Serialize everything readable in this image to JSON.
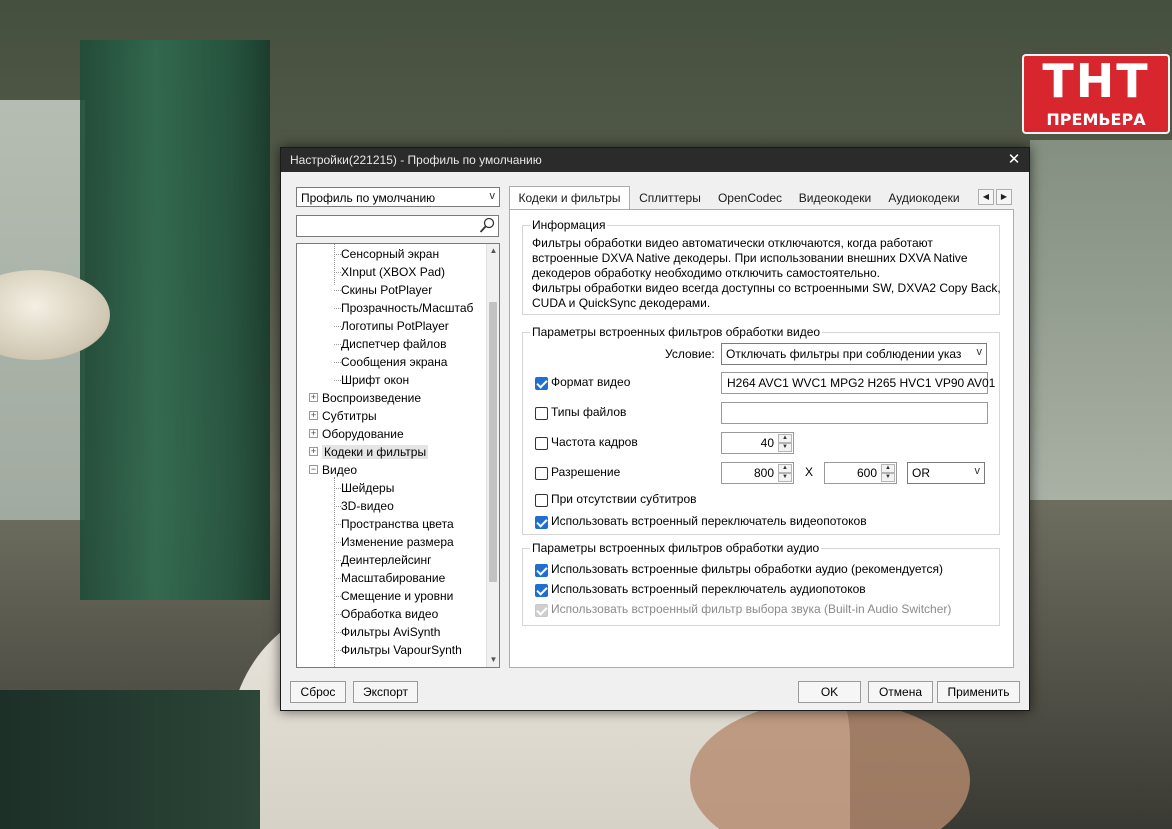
{
  "overlay_logo": {
    "big": "ТНТ",
    "small": "ПРЕМЬЕРА"
  },
  "dialog": {
    "title": "Настройки(221215) - Профиль по умолчанию",
    "close_glyph": "✕"
  },
  "profile": {
    "value": "Профиль по умолчанию",
    "arrow": "v"
  },
  "search": {
    "value": ""
  },
  "tree": {
    "items": [
      {
        "label": "Сенсорный экран",
        "level": 2
      },
      {
        "label": "XInput (XBOX Pad)",
        "level": 2
      },
      {
        "label": "Скины PotPlayer",
        "level": 2
      },
      {
        "label": "Прозрачность/Масштаб",
        "level": 2
      },
      {
        "label": "Логотипы PotPlayer",
        "level": 2
      },
      {
        "label": "Диспетчер файлов",
        "level": 2
      },
      {
        "label": "Сообщения экрана",
        "level": 2
      },
      {
        "label": "Шрифт окон",
        "level": 2
      },
      {
        "label": "Воспроизведение",
        "level": 1,
        "expander": "+"
      },
      {
        "label": "Субтитры",
        "level": 1,
        "expander": "+"
      },
      {
        "label": "Оборудование",
        "level": 1,
        "expander": "+"
      },
      {
        "label": "Кодеки и фильтры",
        "level": 1,
        "expander": "+",
        "selected": true
      },
      {
        "label": "Видео",
        "level": 1,
        "expander": "−"
      },
      {
        "label": "Шейдеры",
        "level": 2
      },
      {
        "label": "3D-видео",
        "level": 2
      },
      {
        "label": "Пространства цвета",
        "level": 2
      },
      {
        "label": "Изменение размера",
        "level": 2
      },
      {
        "label": "Деинтерлейсинг",
        "level": 2
      },
      {
        "label": "Масштабирование",
        "level": 2
      },
      {
        "label": "Смещение и уровни",
        "level": 2
      },
      {
        "label": "Обработка видео",
        "level": 2
      },
      {
        "label": "Фильтры AviSynth",
        "level": 2
      },
      {
        "label": "Фильтры VapourSynth",
        "level": 2
      }
    ]
  },
  "tabs": [
    {
      "label": "Кодеки и фильтры",
      "active": true
    },
    {
      "label": "Сплиттеры"
    },
    {
      "label": "OpenCodec"
    },
    {
      "label": "Видеокодеки"
    },
    {
      "label": "Аудиокодеки"
    }
  ],
  "tab_nav": {
    "prev": "◀",
    "next": "▶"
  },
  "info_group": {
    "caption": "Информация",
    "lines": [
      "Фильтры обработки видео автоматически отключаются, когда работают",
      "встроенные DXVA Native декодеры. При использовании внешних DXVA Native",
      "декодеров обработку необходимо отключить самостоятельно.",
      "Фильтры обработки видео всегда доступны со встроенными SW, DXVA2 Copy Back,",
      "CUDA и QuickSync декодерами."
    ]
  },
  "video_group": {
    "caption": "Параметры встроенных фильтров обработки видео",
    "condition_label": "Условие:",
    "condition_value": "Отключать фильтры при соблюдении указ",
    "condition_arrow": "v",
    "format": {
      "label": "Формат видео",
      "checked": true,
      "value": "H264 AVC1 WVC1 MPG2 H265 HVC1 VP90 AV01"
    },
    "filetypes": {
      "label": "Типы файлов",
      "checked": false,
      "value": ""
    },
    "framerate": {
      "label": "Частота кадров",
      "checked": false,
      "value": "40"
    },
    "resolution": {
      "label": "Разрешение",
      "checked": false,
      "width": "800",
      "x": "X",
      "height": "600",
      "op": "OR",
      "op_arrow": "v"
    },
    "nosubs": {
      "label": "При отсутствии субтитров",
      "checked": false
    },
    "switcher": {
      "label": "Использовать встроенный переключатель видеопотоков",
      "checked": true
    }
  },
  "audio_group": {
    "caption": "Параметры встроенных фильтров обработки аудио",
    "opt1": {
      "label": "Использовать встроенные фильтры обработки аудио (рекомендуется)",
      "checked": true
    },
    "opt2": {
      "label": "Использовать встроенный переключатель аудиопотоков",
      "checked": true
    },
    "opt3": {
      "label": "Использовать встроенный фильтр выбора звука (Built-in Audio Switcher)",
      "checked": true,
      "disabled": true
    }
  },
  "buttons": {
    "reset": "Сброс",
    "export": "Экспорт",
    "ok": "OK",
    "cancel": "Отмена",
    "apply": "Применить"
  }
}
